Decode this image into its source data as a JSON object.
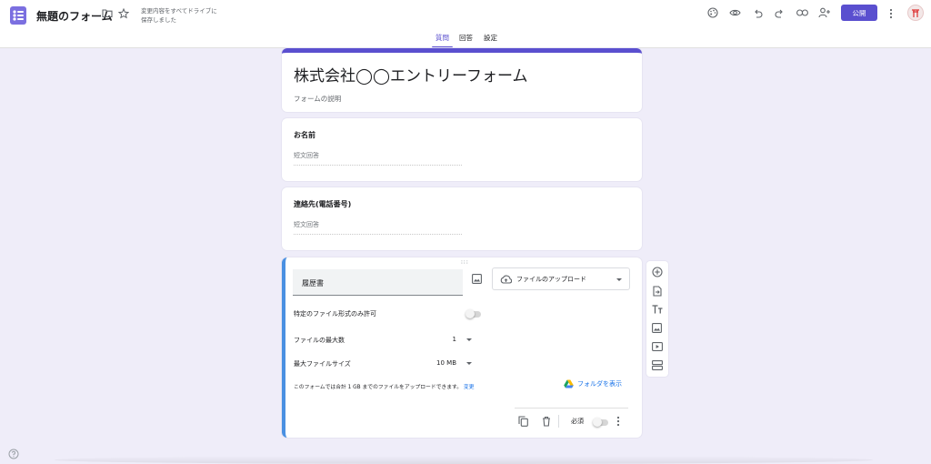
{
  "app": {
    "doc_title": "無題のフォーム",
    "save_status": "変更内容をすべてドライブに\n保存しました",
    "publish_label": "公開",
    "accent_color": "#5a4fcf"
  },
  "icons": {
    "app_logo": "forms-logo-icon",
    "folder": "folder-icon",
    "star": "star-icon",
    "palette": "palette-icon",
    "preview": "eye-icon",
    "undo": "undo-icon",
    "redo": "redo-icon",
    "link": "link-icon",
    "add_collaborator": "add-person-icon",
    "more": "more-vert-icon",
    "help": "help-icon"
  },
  "tabs": [
    {
      "label": "質問",
      "active": true
    },
    {
      "label": "回答",
      "active": false
    },
    {
      "label": "設定",
      "active": false
    }
  ],
  "form": {
    "title": "株式会社◯◯エントリーフォーム",
    "description_placeholder": "フォームの説明"
  },
  "questions": [
    {
      "label": "お名前",
      "answer_placeholder": "短文回答"
    },
    {
      "label": "連絡先(電話番号)",
      "answer_placeholder": "短文回答"
    }
  ],
  "active_question": {
    "title": "履歴書",
    "type_label": "ファイルのアップロード",
    "settings": {
      "file_type_label": "特定のファイル形式のみ許可",
      "file_type_enabled": false,
      "max_files_label": "ファイルの最大数",
      "max_files_value": "1",
      "max_size_label": "最大ファイルサイズ",
      "max_size_value": "10 MB"
    },
    "note_text": "このフォームでは合計 1 GB までのファイルをアップロードできます。",
    "note_link": "変更",
    "folder_link": "フォルダを表示",
    "required_label": "必須",
    "required_enabled": false
  },
  "side_toolbar": [
    "add-question-icon",
    "import-questions-icon",
    "add-title-icon",
    "add-image-icon",
    "add-video-icon",
    "add-section-icon"
  ]
}
